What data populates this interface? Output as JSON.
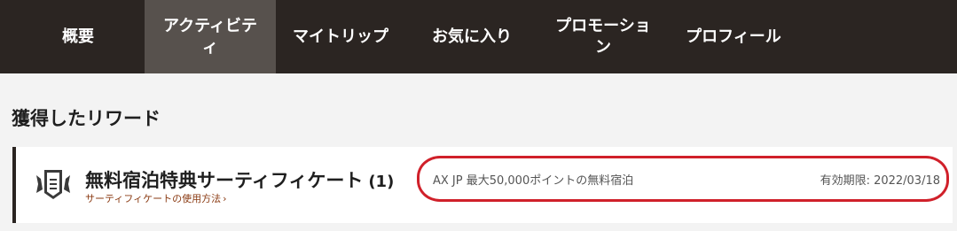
{
  "nav": {
    "items": [
      {
        "label": "概要"
      },
      {
        "label_line1": "アクティビテ",
        "label_line2": "ィ"
      },
      {
        "label": "マイトリップ"
      },
      {
        "label": "お気に入り"
      },
      {
        "label_line1": "プロモーショ",
        "label_line2": "ン"
      },
      {
        "label": "プロフィール"
      }
    ],
    "active_index": 1
  },
  "section": {
    "title": "獲得したリワード"
  },
  "reward": {
    "icon": "certificate-badge-icon",
    "title": "無料宿泊特典サーティフィケート",
    "count": "(1)",
    "howto_link": "サーティフィケートの使用方法",
    "description": "AX JP 最大50,000ポイントの無料宿泊",
    "expiry_label": "有効期限:",
    "expiry_date": "2022/03/18"
  },
  "colors": {
    "nav_bg": "#2b2522",
    "nav_active_bg": "#57514d",
    "highlight": "#d0202a",
    "link": "#8a3a12"
  }
}
